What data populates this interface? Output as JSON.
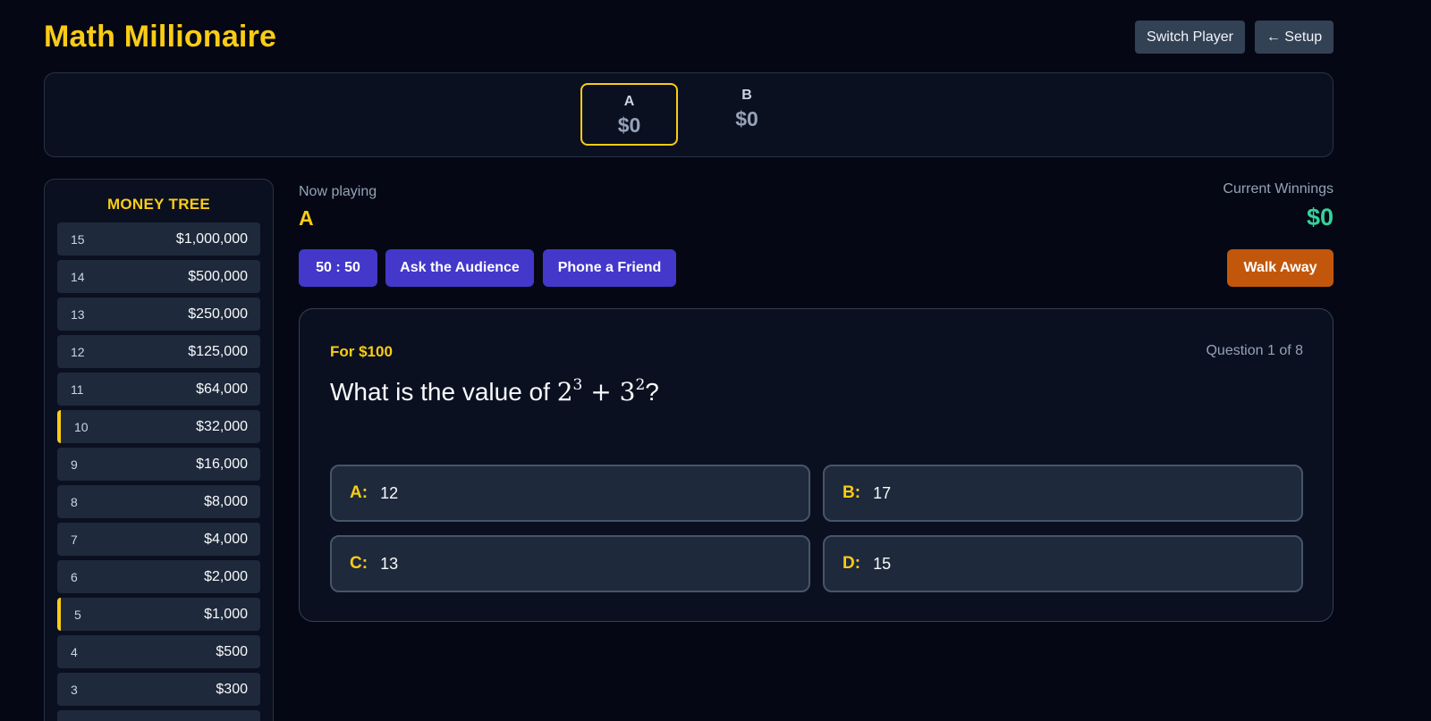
{
  "header": {
    "title": "Math Millionaire",
    "switch_player_label": "Switch Player",
    "setup_label": "← Setup"
  },
  "scoreboard": {
    "players": [
      {
        "name": "A",
        "score": "$0",
        "active": true
      },
      {
        "name": "B",
        "score": "$0",
        "active": false
      }
    ]
  },
  "money_tree": {
    "title": "MONEY TREE",
    "rows": [
      {
        "level": "15",
        "amount": "$1,000,000",
        "safe": false
      },
      {
        "level": "14",
        "amount": "$500,000",
        "safe": false
      },
      {
        "level": "13",
        "amount": "$250,000",
        "safe": false
      },
      {
        "level": "12",
        "amount": "$125,000",
        "safe": false
      },
      {
        "level": "11",
        "amount": "$64,000",
        "safe": false
      },
      {
        "level": "10",
        "amount": "$32,000",
        "safe": true
      },
      {
        "level": "9",
        "amount": "$16,000",
        "safe": false
      },
      {
        "level": "8",
        "amount": "$8,000",
        "safe": false
      },
      {
        "level": "7",
        "amount": "$4,000",
        "safe": false
      },
      {
        "level": "6",
        "amount": "$2,000",
        "safe": false
      },
      {
        "level": "5",
        "amount": "$1,000",
        "safe": true
      },
      {
        "level": "4",
        "amount": "$500",
        "safe": false
      },
      {
        "level": "3",
        "amount": "$300",
        "safe": false
      },
      {
        "level": "",
        "amount": "",
        "safe": false
      }
    ]
  },
  "status": {
    "now_playing_label": "Now playing",
    "now_playing_player": "A",
    "winnings_label": "Current Winnings",
    "winnings_value": "$0"
  },
  "lifelines": {
    "fifty_fifty": "50 : 50",
    "ask_audience": "Ask the Audience",
    "phone_friend": "Phone a Friend",
    "walk_away": "Walk Away"
  },
  "question": {
    "prize": "For $100",
    "counter": "Question 1 of 8",
    "prefix": "What is the value of ",
    "base1": "2",
    "exp1": "3",
    "op": " + ",
    "base2": "3",
    "exp2": "2",
    "suffix": "?",
    "answers": [
      {
        "letter": "A:",
        "text": "12"
      },
      {
        "letter": "B:",
        "text": "17"
      },
      {
        "letter": "C:",
        "text": "13"
      },
      {
        "letter": "D:",
        "text": "15"
      }
    ]
  },
  "colors": {
    "background": "#050814",
    "accent_yellow": "#facc15",
    "winnings_green": "#34d399",
    "lifeline_indigo": "#4338ca",
    "walk_away_orange": "#c2570c"
  }
}
